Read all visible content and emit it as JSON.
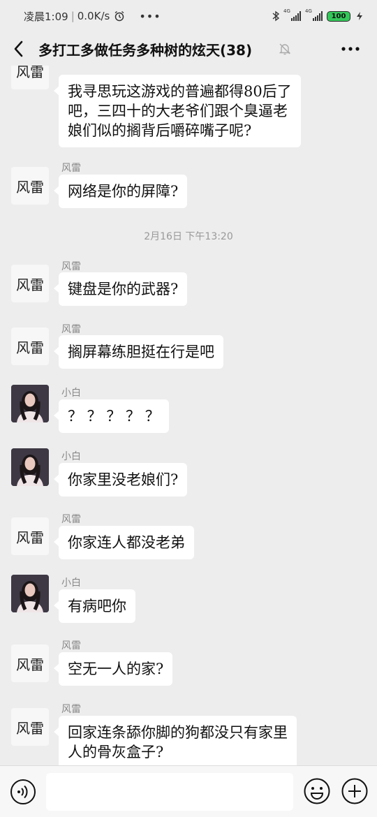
{
  "status_bar": {
    "time": "凌晨1:09",
    "network_speed": "0.0K/s",
    "sim1_label": "4G",
    "sim2_label": "4G",
    "battery": "100",
    "icons": [
      "alarm-clock-icon",
      "more-dots-icon",
      "bluetooth-icon",
      "signal-icon",
      "signal-icon",
      "battery-icon",
      "charging-icon"
    ]
  },
  "header": {
    "title": "多打工多做任务多种树的炫天(38)",
    "icons": [
      "back-icon",
      "mute-bell-icon",
      "more-icon"
    ]
  },
  "messages": [
    {
      "sender": "",
      "avatar": "fenglei-calligraphy-avatar",
      "lines": [
        "我寻思玩这游戏的普遍都得80后了",
        "吧，三四十的大老爷们跟个臭逼老",
        "娘们似的搁背后嚼碎嘴子呢?"
      ]
    },
    {
      "sender": "风雷",
      "avatar": "fenglei-calligraphy-avatar",
      "lines": [
        "网络是你的屏障?"
      ]
    },
    {
      "sender": "风雷",
      "avatar": "fenglei-calligraphy-avatar",
      "lines": [
        "键盘是你的武器?"
      ]
    },
    {
      "sender": "风雷",
      "avatar": "fenglei-calligraphy-avatar",
      "lines": [
        "搁屏幕练胆挺在行是吧"
      ]
    },
    {
      "sender": "小白",
      "avatar": "xiaobai-photo-avatar",
      "lines": [
        "？ ？ ？ ？ ？"
      ]
    },
    {
      "sender": "小白",
      "avatar": "xiaobai-photo-avatar",
      "lines": [
        "你家里没老娘们?"
      ]
    },
    {
      "sender": "风雷",
      "avatar": "fenglei-calligraphy-avatar",
      "lines": [
        "你家连人都没老弟"
      ]
    },
    {
      "sender": "小白",
      "avatar": "xiaobai-photo-avatar",
      "lines": [
        "有病吧你"
      ]
    },
    {
      "sender": "风雷",
      "avatar": "fenglei-calligraphy-avatar",
      "lines": [
        "空无一人的家?"
      ]
    },
    {
      "sender": "风雷",
      "avatar": "fenglei-calligraphy-avatar",
      "lines": [
        "回家连条舔你脚的狗都没只有家里",
        "人的骨灰盒子?"
      ]
    }
  ],
  "timestamp": "2月16日 下午13:20",
  "avatar_text": {
    "fenglei": "风雷"
  },
  "input_bar": {
    "placeholder": "",
    "icons": [
      "voice-icon",
      "emoji-icon",
      "plus-icon"
    ]
  },
  "colors": {
    "background": "#ededed",
    "bubble": "#ffffff",
    "battery": "#34c759",
    "sender_name": "#888888"
  }
}
